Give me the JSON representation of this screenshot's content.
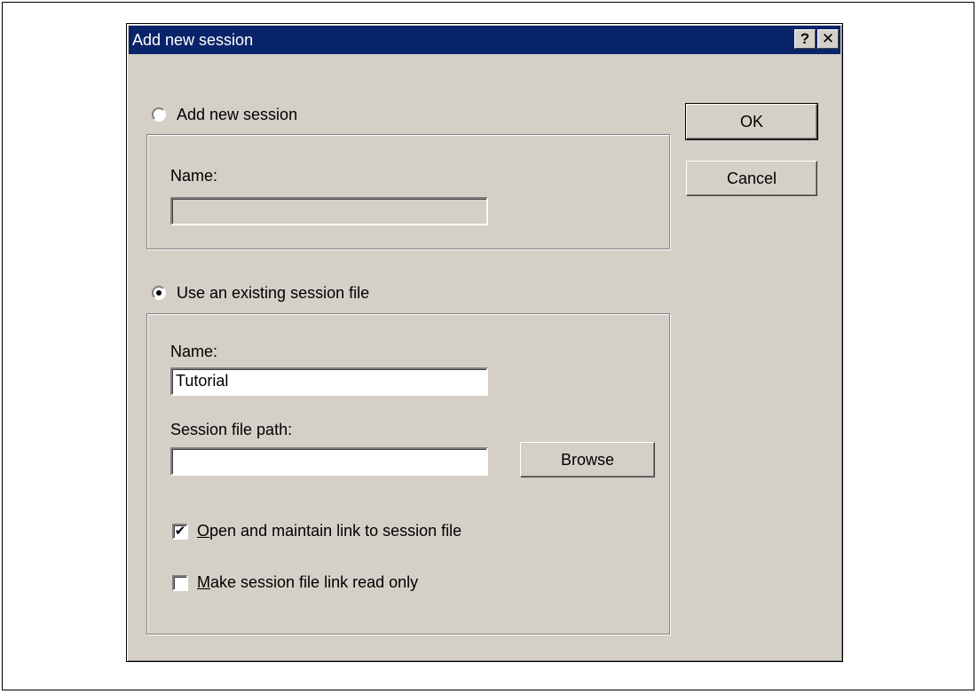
{
  "dialog": {
    "title": "Add new session",
    "help_glyph": "?",
    "close_glyph": "✕"
  },
  "option_new": {
    "label": "Add new session",
    "selected": false,
    "name_label": "Name:",
    "name_value": ""
  },
  "option_existing": {
    "label": "Use an existing session file",
    "selected": true,
    "name_label": "Name:",
    "name_value": "Tutorial",
    "path_label": "Session file path:",
    "path_value": "",
    "browse_label": "Browse",
    "maintain_link": {
      "mnemonic": "O",
      "rest": "pen and maintain link to session file",
      "checked": true,
      "check_glyph": "✔"
    },
    "read_only": {
      "mnemonic": "M",
      "rest": "ake session file link read only",
      "checked": false,
      "check_glyph": ""
    }
  },
  "buttons": {
    "ok": "OK",
    "cancel": "Cancel"
  }
}
